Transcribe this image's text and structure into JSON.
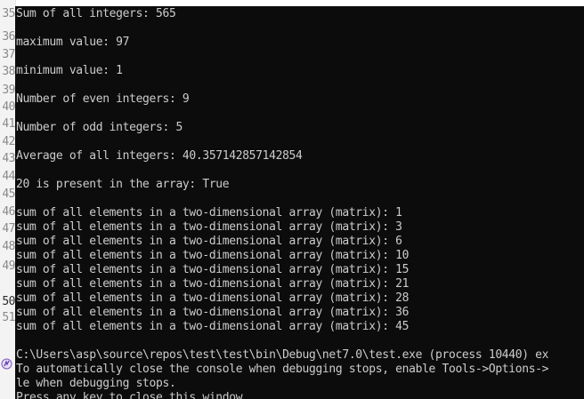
{
  "gutter": {
    "line_numbers": [
      {
        "n": "35",
        "current": false
      },
      {
        "n": "36",
        "current": false
      },
      {
        "n": "37",
        "current": false
      },
      {
        "n": "38",
        "current": false
      },
      {
        "n": "39",
        "current": false
      },
      {
        "n": "40",
        "current": false
      },
      {
        "n": "41",
        "current": false
      },
      {
        "n": "42",
        "current": false
      },
      {
        "n": "43",
        "current": false
      },
      {
        "n": "44",
        "current": false
      },
      {
        "n": "45",
        "current": false
      },
      {
        "n": "46",
        "current": false
      },
      {
        "n": "47",
        "current": false
      },
      {
        "n": "48",
        "current": false
      },
      {
        "n": "49",
        "current": false
      },
      {
        "n": "50",
        "current": true
      },
      {
        "n": "51",
        "current": false
      }
    ],
    "icon": "diagnostic-icon"
  },
  "console": {
    "lines": [
      "Sum of all integers: 565",
      "",
      "maximum value: 97",
      "",
      "minimum value: 1",
      "",
      "Number of even integers: 9",
      "",
      "Number of odd integers: 5",
      "",
      "Average of all integers: 40.357142857142854",
      "",
      "20 is present in the array: True",
      "",
      "sum of all elements in a two-dimensional array (matrix): 1",
      "sum of all elements in a two-dimensional array (matrix): 3",
      "sum of all elements in a two-dimensional array (matrix): 6",
      "sum of all elements in a two-dimensional array (matrix): 10",
      "sum of all elements in a two-dimensional array (matrix): 15",
      "sum of all elements in a two-dimensional array (matrix): 21",
      "sum of all elements in a two-dimensional array (matrix): 28",
      "sum of all elements in a two-dimensional array (matrix): 36",
      "sum of all elements in a two-dimensional array (matrix): 45",
      "",
      "C:\\Users\\asp\\source\\repos\\test\\test\\bin\\Debug\\net7.0\\test.exe (process 10440) ex",
      "To automatically close the console when debugging stops, enable Tools->Options->",
      "le when debugging stops.",
      "Press any key to close this window . . ."
    ]
  },
  "colors": {
    "console_bg": "#0c0c0c",
    "console_fg": "#cccccc",
    "gutter_bg": "#f3f3f3",
    "gutter_fg": "#8a8a8a"
  }
}
